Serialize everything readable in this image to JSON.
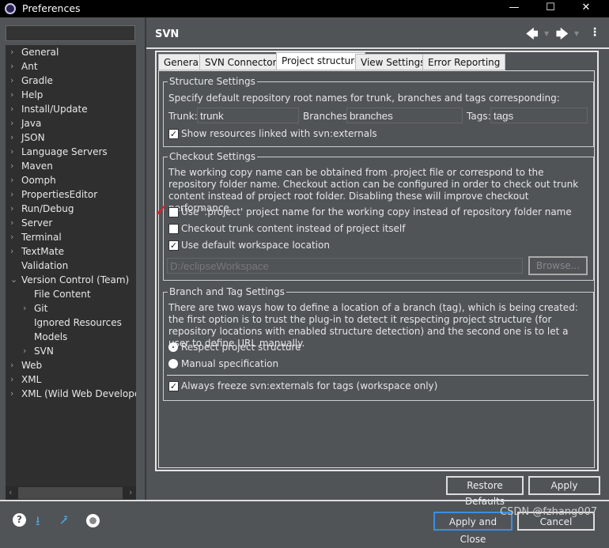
{
  "window": {
    "title": "Preferences",
    "min": "—",
    "max": "☐",
    "close": "✕"
  },
  "sidebar": {
    "filter_value": "",
    "items": [
      {
        "label": "General",
        "arrow": true,
        "indent": 0
      },
      {
        "label": "Ant",
        "arrow": true,
        "indent": 0
      },
      {
        "label": "Gradle",
        "arrow": true,
        "indent": 0
      },
      {
        "label": "Help",
        "arrow": true,
        "indent": 0
      },
      {
        "label": "Install/Update",
        "arrow": true,
        "indent": 0
      },
      {
        "label": "Java",
        "arrow": true,
        "indent": 0
      },
      {
        "label": "JSON",
        "arrow": true,
        "indent": 0
      },
      {
        "label": "Language Servers",
        "arrow": true,
        "indent": 0
      },
      {
        "label": "Maven",
        "arrow": true,
        "indent": 0
      },
      {
        "label": "Oomph",
        "arrow": true,
        "indent": 0
      },
      {
        "label": "PropertiesEditor",
        "arrow": true,
        "indent": 0
      },
      {
        "label": "Run/Debug",
        "arrow": true,
        "indent": 0
      },
      {
        "label": "Server",
        "arrow": true,
        "indent": 0
      },
      {
        "label": "Terminal",
        "arrow": true,
        "indent": 0
      },
      {
        "label": "TextMate",
        "arrow": true,
        "indent": 0
      },
      {
        "label": "Validation",
        "arrow": false,
        "indent": 0
      },
      {
        "label": "Version Control (Team)",
        "arrow": true,
        "expanded": true,
        "indent": 0
      },
      {
        "label": "File Content",
        "arrow": false,
        "indent": 1
      },
      {
        "label": "Git",
        "arrow": true,
        "indent": 1
      },
      {
        "label": "Ignored Resources",
        "arrow": false,
        "indent": 1
      },
      {
        "label": "Models",
        "arrow": false,
        "indent": 1
      },
      {
        "label": "SVN",
        "arrow": true,
        "indent": 1
      },
      {
        "label": "Web",
        "arrow": true,
        "indent": 0
      },
      {
        "label": "XML",
        "arrow": true,
        "indent": 0
      },
      {
        "label": "XML (Wild Web Developer)",
        "arrow": true,
        "indent": 0
      }
    ]
  },
  "header": {
    "title": "SVN",
    "back_icon": "arrow-left-icon",
    "forward_icon": "arrow-right-icon",
    "menu_icon": "kebab-menu-icon"
  },
  "tabs": [
    "General",
    "SVN Connector",
    "Project structure",
    "View Settings",
    "Error Reporting"
  ],
  "active_tab": "Project structure",
  "structure": {
    "legend": "Structure Settings",
    "desc": "Specify default repository root names for trunk, branches and tags corresponding:",
    "trunk_label": "Trunk:",
    "trunk_value": "trunk",
    "branches_label": "Branches:",
    "branches_value": "branches",
    "tags_label": "Tags:",
    "tags_value": "tags",
    "show_externals": {
      "label": "Show resources linked with svn:externals",
      "checked": true
    }
  },
  "checkout": {
    "legend": "Checkout Settings",
    "desc": "The working copy name can be obtained from .project file or correspond to the repository folder name. Checkout action can be configured in order to check out trunk content instead of project root folder. Disabling these will improve checkout performance.",
    "use_project": {
      "label": "Use '.project' project name for the working copy instead of repository folder name",
      "checked": false
    },
    "trunk_content": {
      "label": "Checkout trunk content instead of project itself",
      "checked": false
    },
    "default_ws": {
      "label": "Use default workspace location",
      "checked": true
    },
    "location_value": "D:/eclipseWorkspace",
    "browse": "Browse...",
    "annotation": "✓"
  },
  "branch": {
    "legend": "Branch and Tag Settings",
    "desc": "There are two ways how to define a location of a branch (tag), which is being created: the first option is to trust the plug-in to detect it respecting project structure (for repository locations with enabled structure detection) and the second one is to let a user to define URL manually.",
    "respect": {
      "label": "Respect project structure",
      "selected": true
    },
    "manual": {
      "label": "Manual specification",
      "selected": false
    },
    "freeze": {
      "label": "Always freeze svn:externals for tags (workspace only)",
      "checked": true
    }
  },
  "buttons": {
    "restore": "Restore Defaults",
    "apply": "Apply",
    "apply_close": "Apply and Close",
    "cancel": "Cancel"
  },
  "footer_icons": [
    "help-icon",
    "import-icon",
    "export-icon",
    "record-icon"
  ],
  "watermark": "CSDN @fzhang007"
}
